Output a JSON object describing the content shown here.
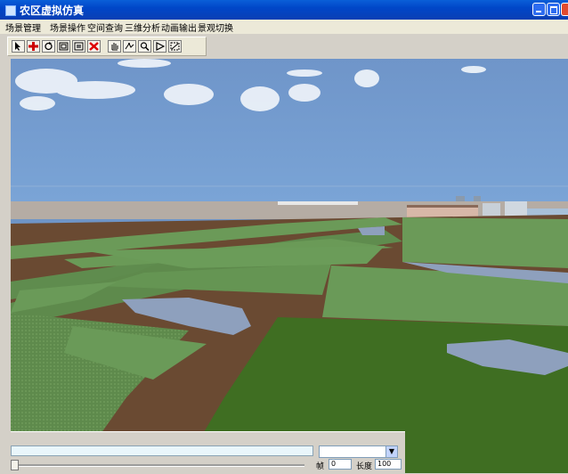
{
  "window": {
    "title": "农区虚拟仿真"
  },
  "menu": [
    "场景管理",
    "场景操作",
    "空间查询",
    "三维分析",
    "动画输出",
    "景观切换"
  ],
  "toolbar": {
    "icons": [
      "pointer-icon",
      "move-icon",
      "rotate-icon",
      "zoom-box-icon",
      "full-extent-icon",
      "delete-icon",
      "pan-icon",
      "fly-icon",
      "zoom-icon",
      "play-icon",
      "fit-view-icon"
    ]
  },
  "colors": {
    "titlebar": "#0046c8",
    "sky": "#6f95c7",
    "field": "#5f8a4a",
    "soil": "#6a4a30",
    "water": "#8ea0bd"
  },
  "playback": {
    "frame_label": "帧",
    "frame_value": "0",
    "length_label": "长度",
    "length_value": "100",
    "combo_value": "",
    "progress": 0
  }
}
